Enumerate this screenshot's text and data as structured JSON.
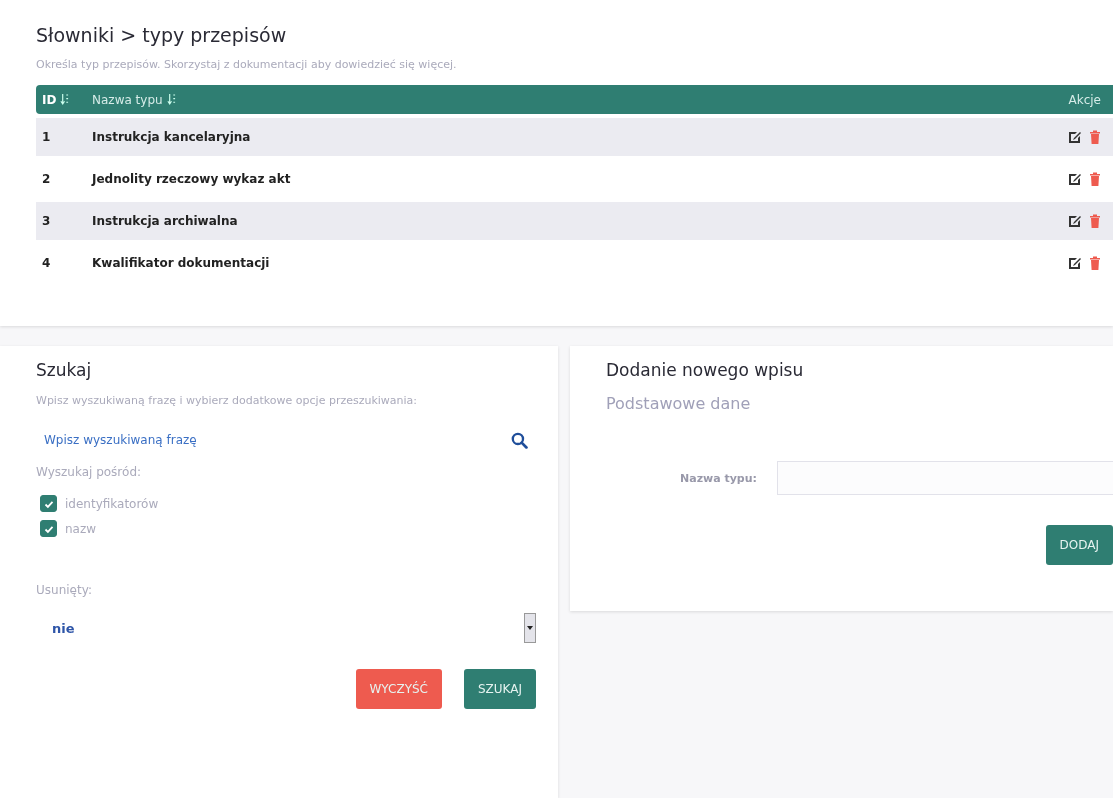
{
  "title": "Słowniki > typy przepisów",
  "description": "Określa typ przepisów. Skorzystaj z dokumentacji aby dowiedzieć się więcej.",
  "table": {
    "columns": [
      {
        "label": "ID",
        "sortable": true
      },
      {
        "label": "Nazwa typu",
        "sortable": true
      },
      {
        "label": "Akcje",
        "sortable": false
      }
    ],
    "rows": [
      {
        "id": "1",
        "name": "Instrukcja kancelaryjna"
      },
      {
        "id": "2",
        "name": "Jednolity rzeczowy wykaz akt"
      },
      {
        "id": "3",
        "name": "Instrukcja archiwalna"
      },
      {
        "id": "4",
        "name": "Kwalifikator dokumentacji"
      }
    ]
  },
  "search": {
    "title": "Szukaj",
    "hint": "Wpisz wyszukiwaną frazę i wybierz dodatkowe opcje przeszukiwania:",
    "field": {
      "placeholder": "Wpisz wyszukiwaną frazę"
    },
    "scope_label": "Wyszukaj pośród:",
    "options": [
      {
        "label": "identyfikatorów",
        "checked": true
      },
      {
        "label": "nazw",
        "checked": true
      }
    ],
    "deleted_label": "Usunięty:",
    "deleted_value": "nie",
    "buttons": [
      {
        "label": "WYCZYŚĆ",
        "kind": "danger"
      },
      {
        "label": "SZUKAJ",
        "kind": "primary"
      }
    ]
  },
  "add": {
    "title": "Dodanie nowego wpisu",
    "subtitle": "Podstawowe dane",
    "field_label": "Nazwa typu:",
    "button": "DODAJ"
  }
}
